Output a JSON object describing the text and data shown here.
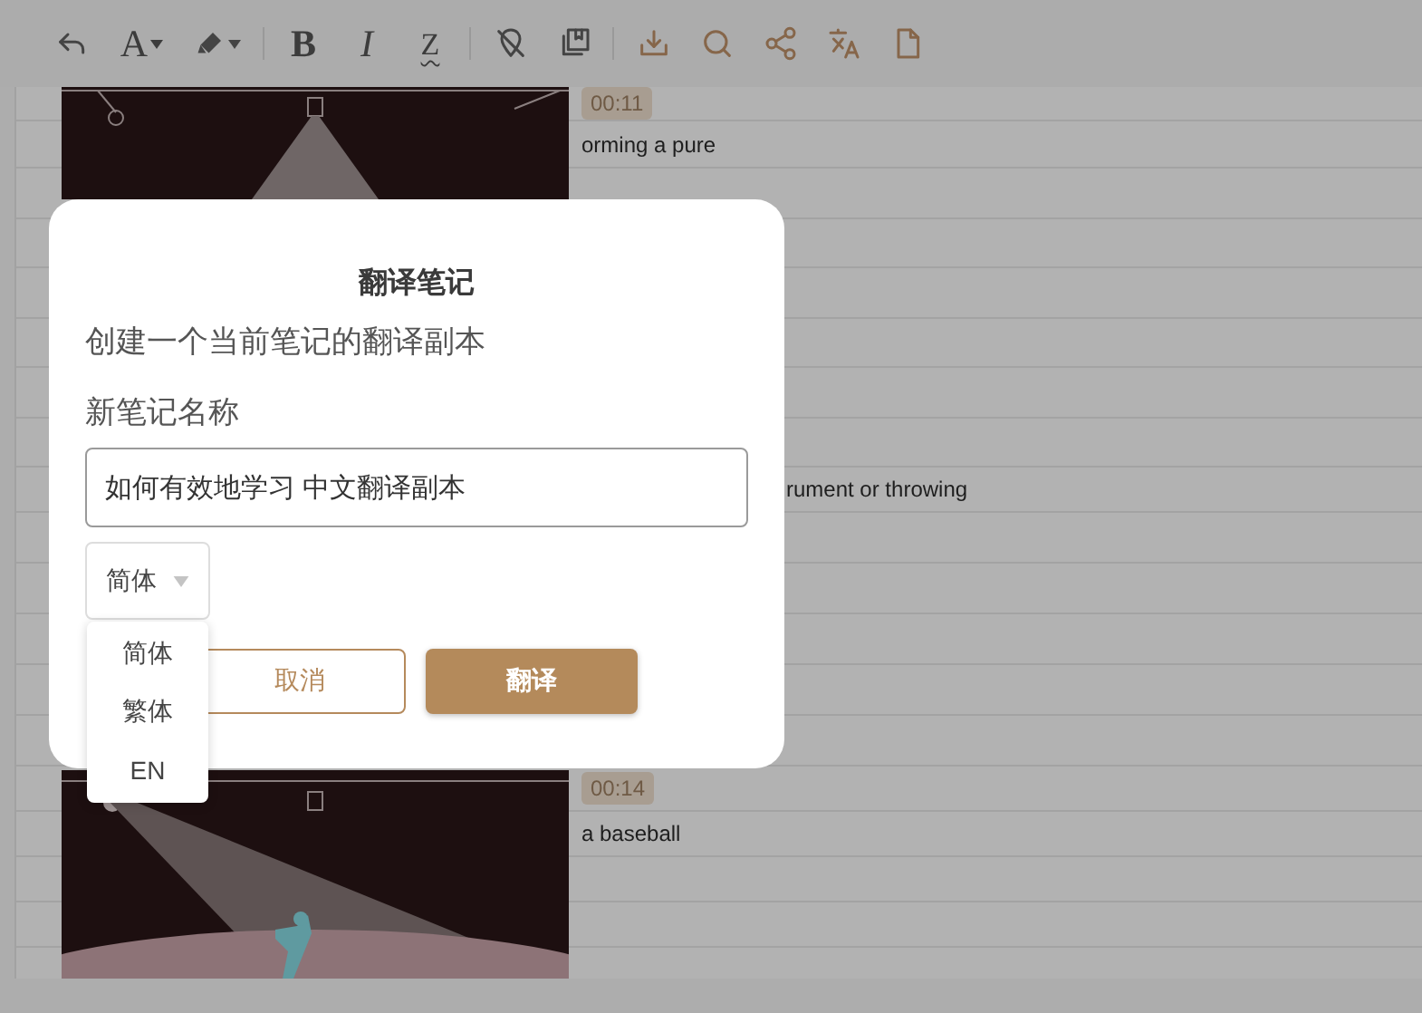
{
  "toolbar": {
    "font_button": "A",
    "format_buttons": [
      "B",
      "I",
      "Z"
    ]
  },
  "notes": [
    {
      "time": "00:11",
      "text": "orming a pure"
    },
    {
      "text": "rument or throwing"
    },
    {
      "time": "00:14",
      "text": "a baseball"
    }
  ],
  "dialog": {
    "title": "翻译笔记",
    "subtitle": "创建一个当前笔记的翻译副本",
    "name_label": "新笔记名称",
    "name_value": "如何有效地学习 中文翻译副本",
    "language_select": {
      "value": "简体",
      "expanded": true,
      "options": [
        "简体",
        "繁体",
        "EN"
      ]
    },
    "buttons": [
      {
        "label": "取消",
        "kind": "secondary"
      },
      {
        "label": "翻译",
        "kind": "primary"
      }
    ]
  }
}
